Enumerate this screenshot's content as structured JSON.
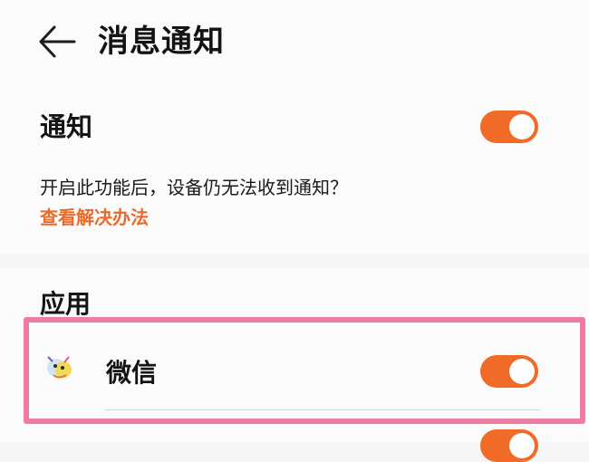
{
  "header": {
    "title": "消息通知",
    "back_icon": "arrow-left-icon"
  },
  "notification": {
    "label": "通知",
    "enabled": true,
    "notice_text": "开启此功能后，设备仍无法收到通知？",
    "help_link": "查看解决办法"
  },
  "apps": {
    "section_title": "应用",
    "items": [
      {
        "name": "微信",
        "icon": "wechat-app-icon",
        "enabled": true
      }
    ]
  },
  "colors": {
    "accent": "#f06a28",
    "link": "#ea6a2a",
    "highlight_border": "#ef7ca4",
    "background": "#fbfbfb",
    "separator_band": "#f6f6f6"
  }
}
